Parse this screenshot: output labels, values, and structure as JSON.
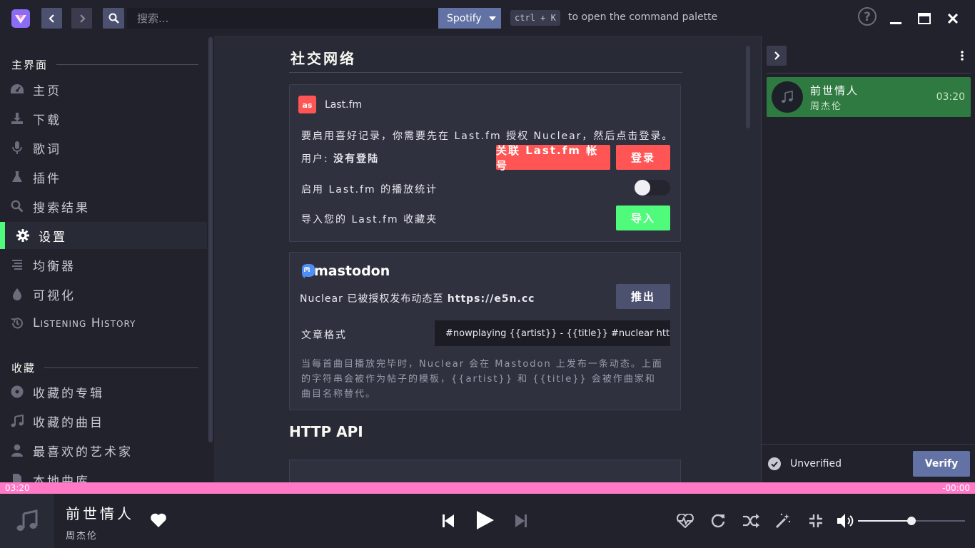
{
  "topbar": {
    "search_placeholder": "搜索...",
    "source": "Spotify",
    "kbd": "ctrl + K",
    "command_hint": "to open the command palette"
  },
  "sidebar": {
    "section_main": "主界面",
    "items_main": [
      "主页",
      "下载",
      "歌词",
      "插件",
      "搜索结果",
      "设置",
      "均衡器",
      "可视化",
      "Listening History"
    ],
    "section_collection": "收藏",
    "items_collection": [
      "收藏的专辑",
      "收藏的曲目",
      "最喜欢的艺术家",
      "本地曲库"
    ]
  },
  "main": {
    "social_title": "社交网络",
    "lastfm": {
      "name": "Last.fm",
      "info": "要启用喜好记录，你需要先在 Last.fm 授权 Nuclear，然后点击登录。",
      "user_label": "用户:",
      "user_value": "没有登陆",
      "connect_button": "关联 Last.fm 帐号",
      "login_button": "登录",
      "scrobble_label": "启用 Last.fm 的播放统计",
      "scrobble_enabled": false,
      "import_label": "导入您的 Last.fm 收藏夹",
      "import_button": "导入"
    },
    "mastodon": {
      "name": "mastodon",
      "auth_text": "Nuclear 已被授权发布动态至",
      "auth_server": "https://e5n.cc",
      "logout_button": "推出",
      "format_label": "文章格式",
      "format_value": "#nowplaying {{artist}} - {{title}} #nuclear https://nuclear.js.org",
      "description": "当每首曲目播放完毕时，Nuclear 会在 Mastodon 上发布一条动态。上面的字符串会被作为帖子的模板，{{artist}} 和 {{title}} 会被作曲家和曲目名称替代。"
    },
    "http_title": "HTTP API"
  },
  "queue": {
    "item_title": "前世情人",
    "item_artist": "周杰伦",
    "item_duration": "03:20",
    "verify_status": "Unverified",
    "verify_button": "Verify"
  },
  "seek": {
    "elapsed": "03:20",
    "remaining": "-00:00"
  },
  "player": {
    "title": "前世情人",
    "artist": "周杰伦",
    "volume": 0.5
  },
  "colors": {
    "accent_green": "#50fa7b",
    "accent_red": "#ff5555",
    "accent_pink": "#ff79c6",
    "slate": "#6272a4"
  }
}
